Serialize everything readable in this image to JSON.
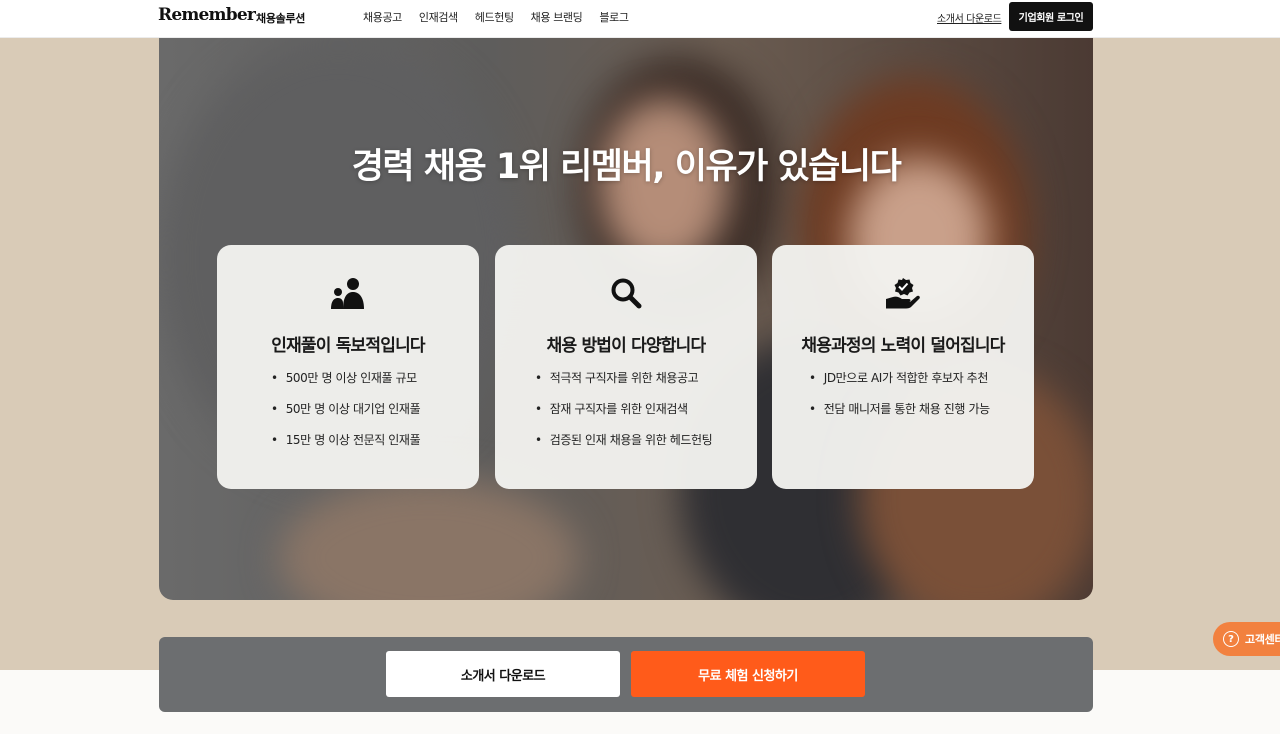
{
  "header": {
    "logo": "Remember",
    "logo_sub": "채용솔루션",
    "nav": [
      "채용공고",
      "인재검색",
      "헤드헌팅",
      "채용 브랜딩",
      "블로그"
    ],
    "download_link": "소개서 다운로드",
    "login_button": "기업회원 로그인"
  },
  "hero": {
    "title": "경력 채용 1위 리멤버, 이유가 있습니다",
    "cards": [
      {
        "icon": "people-icon",
        "title": "인재풀이 독보적입니다",
        "items": [
          "500만 명 이상 인재풀 규모",
          "50만 명 이상 대기업 인재풀",
          "15만 명 이상 전문직 인재풀"
        ]
      },
      {
        "icon": "search-icon",
        "title": "채용 방법이 다양합니다",
        "items": [
          "적극적 구직자를 위한 채용공고",
          "잠재 구직자를 위한 인재검색",
          "검증된 인재 채용을 위한 헤드헌팅"
        ]
      },
      {
        "icon": "verified-hand-icon",
        "title": "채용과정의 노력이 덜어집니다",
        "items": [
          "JD만으로 AI가 적합한 후보자 추천",
          "전담 매니저를 통한 채용 진행 가능"
        ]
      }
    ]
  },
  "cta": {
    "download_label": "소개서 다운로드",
    "trial_label": "무료 체험 신청하기"
  },
  "support": {
    "label": "고객센터"
  },
  "colors": {
    "accent": "#ff5b1a",
    "support": "#f2813f",
    "background": "#d9cbb7"
  }
}
